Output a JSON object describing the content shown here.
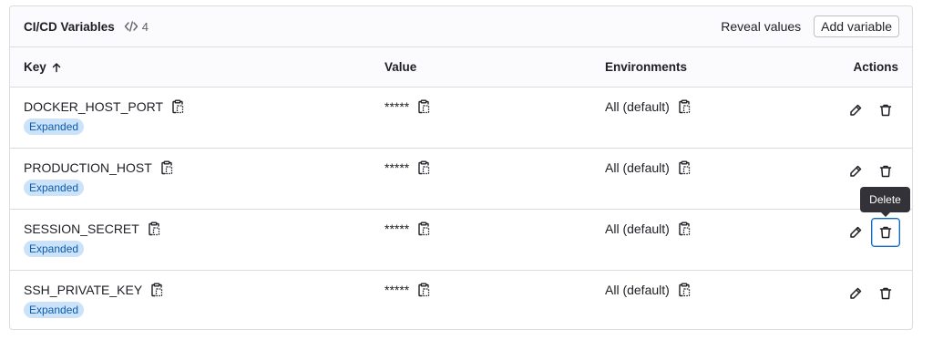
{
  "header": {
    "title": "CI/CD Variables",
    "count": "4",
    "reveal_label": "Reveal values",
    "add_label": "Add variable"
  },
  "columns": {
    "key": "Key",
    "value": "Value",
    "environments": "Environments",
    "actions": "Actions"
  },
  "rows": [
    {
      "key": "DOCKER_HOST_PORT",
      "value": "*****",
      "env": "All (default)",
      "badge": "Expanded"
    },
    {
      "key": "PRODUCTION_HOST",
      "value": "*****",
      "env": "All (default)",
      "badge": "Expanded"
    },
    {
      "key": "SESSION_SECRET",
      "value": "*****",
      "env": "All (default)",
      "badge": "Expanded"
    },
    {
      "key": "SSH_PRIVATE_KEY",
      "value": "*****",
      "env": "All (default)",
      "badge": "Expanded"
    }
  ],
  "tooltip": "Delete",
  "colors": {
    "badge_bg": "#cbe2f9",
    "badge_text": "#0b5cad",
    "focus_border": "#1068bf",
    "tooltip_bg": "#333238"
  }
}
